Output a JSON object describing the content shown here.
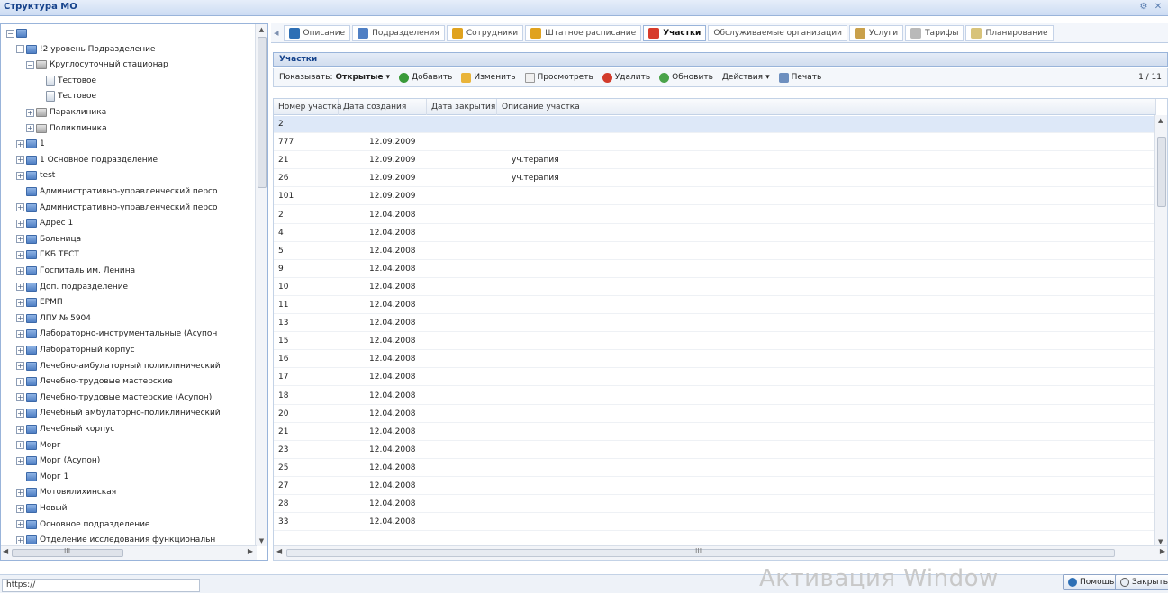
{
  "window": {
    "title": "Структура МО"
  },
  "tree": {
    "nodes": [
      {
        "label": "",
        "depth": 0,
        "expander": "−",
        "icon": "blue"
      },
      {
        "label": "!2 уровень Подразделение",
        "depth": 1,
        "expander": "−",
        "icon": "blue"
      },
      {
        "label": "Круглосуточный стационар",
        "depth": 2,
        "expander": "−",
        "icon": "gray"
      },
      {
        "label": "Тестовое",
        "depth": 3,
        "expander": "",
        "icon": "doc"
      },
      {
        "label": "Тестовое",
        "depth": 3,
        "expander": "",
        "icon": "doc"
      },
      {
        "label": "Параклиника",
        "depth": 2,
        "expander": "+",
        "icon": "gray"
      },
      {
        "label": "Поликлиника",
        "depth": 2,
        "expander": "+",
        "icon": "gray"
      },
      {
        "label": "1",
        "depth": 1,
        "expander": "+",
        "icon": "blue"
      },
      {
        "label": "1 Основное подразделение",
        "depth": 1,
        "expander": "+",
        "icon": "blue"
      },
      {
        "label": "test",
        "depth": 1,
        "expander": "+",
        "icon": "blue"
      },
      {
        "label": "Административно-управленческий персо",
        "depth": 1,
        "expander": "",
        "icon": "blue"
      },
      {
        "label": "Административно-управленческий персо",
        "depth": 1,
        "expander": "+",
        "icon": "blue"
      },
      {
        "label": "Адрес 1",
        "depth": 1,
        "expander": "+",
        "icon": "blue"
      },
      {
        "label": "Больница",
        "depth": 1,
        "expander": "+",
        "icon": "blue"
      },
      {
        "label": "ГКБ ТЕСТ",
        "depth": 1,
        "expander": "+",
        "icon": "blue"
      },
      {
        "label": "Госпиталь им. Ленина",
        "depth": 1,
        "expander": "+",
        "icon": "blue"
      },
      {
        "label": "Доп. подразделение",
        "depth": 1,
        "expander": "+",
        "icon": "blue"
      },
      {
        "label": "ЕРМП",
        "depth": 1,
        "expander": "+",
        "icon": "blue"
      },
      {
        "label": "ЛПУ № 5904",
        "depth": 1,
        "expander": "+",
        "icon": "blue"
      },
      {
        "label": "Лабораторно-инструментальные (Асупон",
        "depth": 1,
        "expander": "+",
        "icon": "blue"
      },
      {
        "label": "Лабораторный корпус",
        "depth": 1,
        "expander": "+",
        "icon": "blue"
      },
      {
        "label": "Лечебно-амбулаторный поликлинический",
        "depth": 1,
        "expander": "+",
        "icon": "blue"
      },
      {
        "label": "Лечебно-трудовые мастерские",
        "depth": 1,
        "expander": "+",
        "icon": "blue"
      },
      {
        "label": "Лечебно-трудовые мастерские (Асупон)",
        "depth": 1,
        "expander": "+",
        "icon": "blue"
      },
      {
        "label": "Лечебный амбулаторно-поликлинический",
        "depth": 1,
        "expander": "+",
        "icon": "blue"
      },
      {
        "label": "Лечебный корпус",
        "depth": 1,
        "expander": "+",
        "icon": "blue"
      },
      {
        "label": "Морг",
        "depth": 1,
        "expander": "+",
        "icon": "blue"
      },
      {
        "label": "Морг (Асупон)",
        "depth": 1,
        "expander": "+",
        "icon": "blue"
      },
      {
        "label": "Морг 1",
        "depth": 1,
        "expander": "",
        "icon": "blue"
      },
      {
        "label": "Мотовилихинская",
        "depth": 1,
        "expander": "+",
        "icon": "blue"
      },
      {
        "label": "Новый",
        "depth": 1,
        "expander": "+",
        "icon": "blue"
      },
      {
        "label": "Основное подразделение",
        "depth": 1,
        "expander": "+",
        "icon": "blue"
      },
      {
        "label": "Отделение исследования функциональн",
        "depth": 1,
        "expander": "+",
        "icon": "blue"
      }
    ],
    "hscroll_grip": "III"
  },
  "tabs": [
    {
      "label": "Описание",
      "icon": "info-icon",
      "color": "#2d6fb5"
    },
    {
      "label": "Подразделения",
      "icon": "folders-icon",
      "color": "#4f7fc4"
    },
    {
      "label": "Сотрудники",
      "icon": "people-icon",
      "color": "#e0a21e"
    },
    {
      "label": "Штатное расписание",
      "icon": "staff-icon",
      "color": "#e0a21e"
    },
    {
      "label": "Участки",
      "icon": "pin-icon",
      "color": "#d73a2a",
      "active": true
    },
    {
      "label": "Обслуживаемые организации",
      "icon": "",
      "color": ""
    },
    {
      "label": "Услуги",
      "icon": "services-icon",
      "color": "#c9a04a"
    },
    {
      "label": "Тарифы",
      "icon": "tariffs-icon",
      "color": "#b9b9b9"
    },
    {
      "label": "Планирование",
      "icon": "plan-icon",
      "color": "#d8c37a"
    }
  ],
  "panel": {
    "title": "Участки"
  },
  "toolbar": {
    "show_label": "Показывать:",
    "show_value": "Открытые",
    "add": "Добавить",
    "edit": "Изменить",
    "view": "Просмотреть",
    "delete": "Удалить",
    "refresh": "Обновить",
    "actions": "Действия",
    "print": "Печать",
    "pager": "1 / 11"
  },
  "grid": {
    "columns": [
      "Номер участка",
      "Дата создания",
      "Дата закрытия",
      "Описание участка"
    ],
    "rows": [
      [
        "2",
        "",
        "",
        ""
      ],
      [
        "777",
        "12.09.2009",
        "",
        ""
      ],
      [
        "21",
        "12.09.2009",
        "",
        "уч.терапия"
      ],
      [
        "26",
        "12.09.2009",
        "",
        "уч.терапия"
      ],
      [
        "101",
        "12.09.2009",
        "",
        ""
      ],
      [
        "2",
        "12.04.2008",
        "",
        ""
      ],
      [
        "4",
        "12.04.2008",
        "",
        ""
      ],
      [
        "5",
        "12.04.2008",
        "",
        ""
      ],
      [
        "9",
        "12.04.2008",
        "",
        ""
      ],
      [
        "10",
        "12.04.2008",
        "",
        ""
      ],
      [
        "11",
        "12.04.2008",
        "",
        ""
      ],
      [
        "13",
        "12.04.2008",
        "",
        ""
      ],
      [
        "15",
        "12.04.2008",
        "",
        ""
      ],
      [
        "16",
        "12.04.2008",
        "",
        ""
      ],
      [
        "17",
        "12.04.2008",
        "",
        ""
      ],
      [
        "18",
        "12.04.2008",
        "",
        ""
      ],
      [
        "20",
        "12.04.2008",
        "",
        ""
      ],
      [
        "21",
        "12.04.2008",
        "",
        ""
      ],
      [
        "23",
        "12.04.2008",
        "",
        ""
      ],
      [
        "25",
        "12.04.2008",
        "",
        ""
      ],
      [
        "27",
        "12.04.2008",
        "",
        ""
      ],
      [
        "28",
        "12.04.2008",
        "",
        ""
      ],
      [
        "33",
        "12.04.2008",
        "",
        ""
      ]
    ],
    "hscroll_grip": "III"
  },
  "status": {
    "url": "https://",
    "watermark": "Активация Window",
    "help": "Помощь",
    "close": "Закрыть"
  }
}
